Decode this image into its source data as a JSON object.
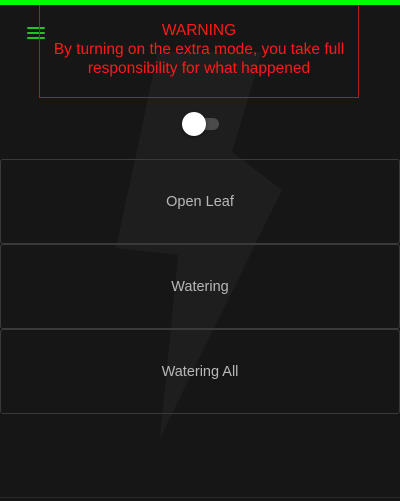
{
  "colors": {
    "accent": "#00ff00",
    "menu_icon": "#21c41f",
    "warning": "#ff1a1a",
    "background": "#161616"
  },
  "warning": {
    "title": "WARNING",
    "line1": "By turning on the extra mode, you take full",
    "line2": "responsibility for what happened"
  },
  "extra_mode_toggle": {
    "state": "off"
  },
  "buttons": [
    {
      "label": "Open Leaf"
    },
    {
      "label": "Watering"
    },
    {
      "label": "Watering All"
    }
  ],
  "icons": {
    "menu": "hamburger-menu-icon",
    "background": "lightning-bolt-icon"
  }
}
